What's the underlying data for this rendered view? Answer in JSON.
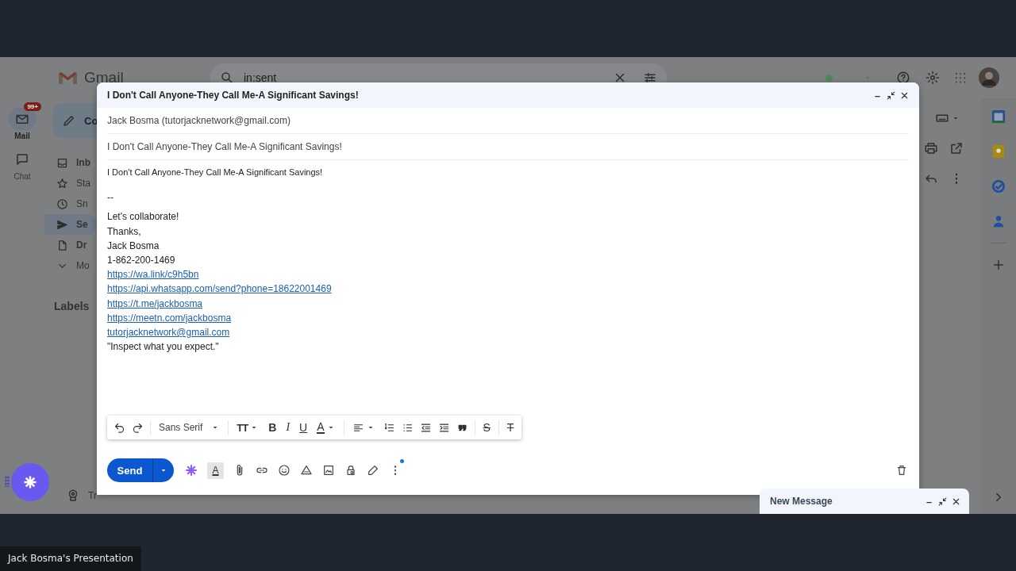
{
  "gmail": {
    "logo_text": "Gmail",
    "search": {
      "value": "in:sent"
    },
    "rail": [
      {
        "kind": "mail",
        "label": "Mail",
        "badge": "99+",
        "selected": true
      },
      {
        "kind": "chat",
        "label": "Chat",
        "selected": false
      }
    ],
    "compose_button": "Co",
    "nav": [
      {
        "kind": "inbox",
        "label": "Inb",
        "selected": false,
        "unread": true
      },
      {
        "kind": "star",
        "label": "Sta",
        "selected": false,
        "unread": false
      },
      {
        "kind": "snooze",
        "label": "Sn",
        "selected": false,
        "unread": false
      },
      {
        "kind": "sent",
        "label": "Se",
        "selected": true,
        "unread": true
      },
      {
        "kind": "draft",
        "label": "Dr",
        "selected": false,
        "unread": true
      },
      {
        "kind": "more",
        "label": "Mo",
        "selected": false,
        "unread": false
      }
    ],
    "labels_heading": "Labels",
    "plan_link": "Tr"
  },
  "compose": {
    "title": "I Don't Call Anyone-They Call Me-A Significant Savings!",
    "from": "Jack Bosma (tutorjacknetwork@gmail.com)",
    "subject": "I Don't Call Anyone-They Call Me-A Significant Savings!",
    "body": [
      {
        "kind": "subject",
        "text": "I Don't Call Anyone-They Call Me-A Significant Savings!"
      },
      {
        "kind": "separator",
        "text": "--"
      },
      {
        "kind": "text",
        "text": "Let's collaborate!"
      },
      {
        "kind": "text",
        "text": "Thanks,"
      },
      {
        "kind": "text",
        "text": "Jack Bosma"
      },
      {
        "kind": "text",
        "text": "1-862-200-1469"
      },
      {
        "kind": "link",
        "text": "https://wa.link/c9h5bn"
      },
      {
        "kind": "link",
        "text": "https://api.whatsapp.com/send?phone=18622001469"
      },
      {
        "kind": "link",
        "text": "https://t.me/jackbosma"
      },
      {
        "kind": "link",
        "text": "https://meetn.com/jackbosma"
      },
      {
        "kind": "link",
        "text": "tutorjacknetwork@gmail.com"
      },
      {
        "kind": "text",
        "text": "\"Inspect what you expect.\""
      }
    ],
    "format_toolbar": [
      {
        "kind": "undo"
      },
      {
        "kind": "redo"
      },
      {
        "kind": "font",
        "text": "Sans Serif",
        "dropdown": true
      },
      {
        "kind": "size",
        "text": "TT",
        "dropdown": true
      },
      {
        "kind": "bold",
        "text": "B"
      },
      {
        "kind": "italic",
        "text": "I"
      },
      {
        "kind": "underline",
        "text": "U"
      },
      {
        "kind": "color",
        "text": "A",
        "dropdown": true
      },
      {
        "kind": "align",
        "dropdown": true
      },
      {
        "kind": "numbered"
      },
      {
        "kind": "bulleted"
      },
      {
        "kind": "outdent"
      },
      {
        "kind": "indent"
      },
      {
        "kind": "quote"
      },
      {
        "kind": "strike",
        "text": "S"
      },
      {
        "kind": "clear",
        "text": "T"
      }
    ],
    "send": "Send",
    "actions": [
      {
        "kind": "ai"
      },
      {
        "kind": "formatting",
        "text": "A",
        "on": true
      },
      {
        "kind": "attach"
      },
      {
        "kind": "link"
      },
      {
        "kind": "emoji"
      },
      {
        "kind": "drive"
      },
      {
        "kind": "photo"
      },
      {
        "kind": "confidential"
      },
      {
        "kind": "signature"
      },
      {
        "kind": "more",
        "dot": true
      }
    ]
  },
  "minimized": {
    "title": "New Message"
  },
  "presentation": {
    "label": "Jack Bosma's Presentation"
  }
}
